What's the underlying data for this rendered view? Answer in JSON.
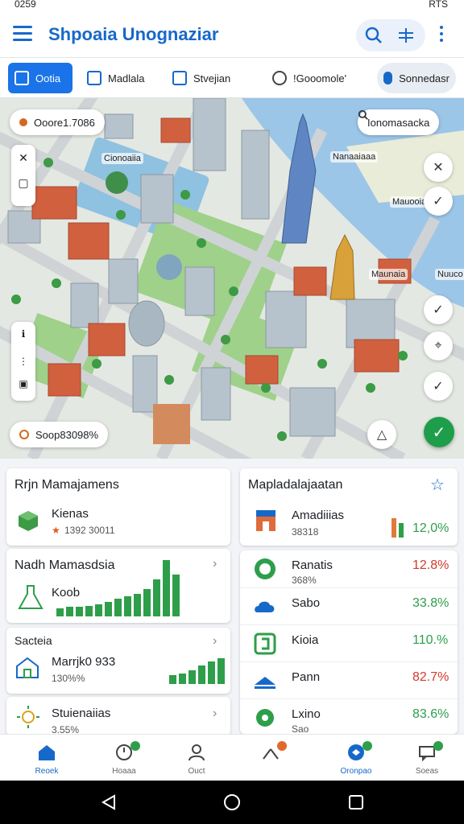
{
  "status_bar": {
    "time": "0259",
    "right": "RTS"
  },
  "app_bar": {
    "title": "Shpoaia Unognaziar"
  },
  "chips": [
    {
      "label": "Ootia"
    },
    {
      "label": "Madlala"
    },
    {
      "label": "Stvejian"
    },
    {
      "label": "!Gooomole'"
    },
    {
      "label": "Sonnedasr"
    }
  ],
  "map": {
    "top_left_pill": "Ooore1.7086",
    "search_pill": "Ionomasacka",
    "bottom_pill": "Soop83098%",
    "labels": [
      "Cionoaiia",
      "Nanaaiaaa",
      "Mauooia",
      "Maunaia",
      "Nuuco"
    ]
  },
  "cards": {
    "left_top": {
      "title": "Rrjn Mamajamens",
      "item_title": "Kienas",
      "item_sub": "1392 30011"
    },
    "left_mid": {
      "title": "Nadh Mamasdsia",
      "item_title": "Koob",
      "bars": [
        10,
        12,
        12,
        13,
        15,
        18,
        22,
        25,
        28,
        34,
        46,
        70,
        52
      ]
    },
    "left_low": {
      "title": "Sacteia",
      "item_title": "Marrjk0 933",
      "item_sub": "130%%",
      "bars": [
        10,
        12,
        16,
        22,
        26,
        30
      ]
    },
    "left_bottom": {
      "item_title": "Stuienaiias",
      "item_sub": "3.55%"
    },
    "right_top": {
      "title": "Mapladalajaatan",
      "item_title": "Amadiiias",
      "item_sub": "38318",
      "pct": "12,0%"
    },
    "right_list": [
      {
        "title": "Ranatis",
        "sub": "368%",
        "pct": "12.8%",
        "pct_color": "#d23a2c",
        "icon": "chat-bubble-icon"
      },
      {
        "title": "Sabo",
        "sub": "",
        "pct": "33.8%",
        "pct_color": "#2e9e4a",
        "icon": "cloud-icon"
      },
      {
        "title": "Kioia",
        "sub": "",
        "pct": "110.%",
        "pct_color": "#2e9e4a",
        "icon": "dollar-icon"
      },
      {
        "title": "Pann",
        "sub": "",
        "pct": "82.7%",
        "pct_color": "#d23a2c",
        "icon": "roof-icon"
      },
      {
        "title": "Lxino",
        "sub": "Sao",
        "pct": "83.6%",
        "pct_color": "#2e9e4a",
        "icon": "gear-icon"
      }
    ]
  },
  "bottom_nav": [
    {
      "label": "Reoek",
      "active": true
    },
    {
      "label": "Hoaaa",
      "active": false
    },
    {
      "label": "Ouct",
      "active": false
    },
    {
      "label": "",
      "active": false
    },
    {
      "label": "Oronpao",
      "active": false
    },
    {
      "label": "Soeas",
      "active": false
    }
  ],
  "colors": {
    "primary": "#1769c9",
    "green": "#2e9e4a",
    "red": "#d23a2c"
  }
}
